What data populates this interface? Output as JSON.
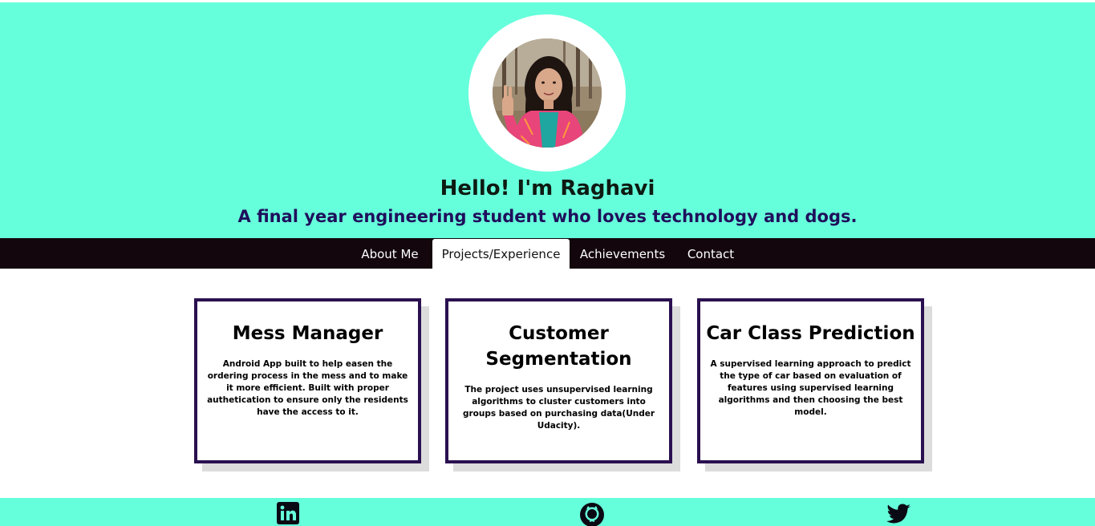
{
  "header": {
    "greeting": "Hello! I'm Raghavi",
    "tagline": "A final year engineering student who loves technology and dogs.",
    "background_color": "#66ffdb"
  },
  "profile": {
    "avatar_icon": "profile-photo"
  },
  "nav": {
    "items": [
      {
        "label": "About Me"
      },
      {
        "label": "Projects/Experience"
      },
      {
        "label": "Achievements"
      },
      {
        "label": "Contact"
      }
    ],
    "active": "Projects/Experience",
    "background_color": "#13060d"
  },
  "projects": [
    {
      "title": "Mess Manager",
      "description": "Android App built to help easen the ordering process in the mess and to make it more efficient. Built with proper authetication to ensure only the residents have the access to it."
    },
    {
      "title": "Customer Segmentation",
      "description": "The project uses unsupervised learning algorithms to cluster customers into groups based on purchasing data(Under Udacity)."
    },
    {
      "title": "Car Class Prediction",
      "description": "A supervised learning approach to predict the type of car based on evaluation of features using supervised learning algorithms and then choosing the best model."
    }
  ],
  "card_border_color": "#2a1050",
  "footer": {
    "icons": [
      "linkedin-icon",
      "github-icon",
      "twitter-icon"
    ]
  }
}
